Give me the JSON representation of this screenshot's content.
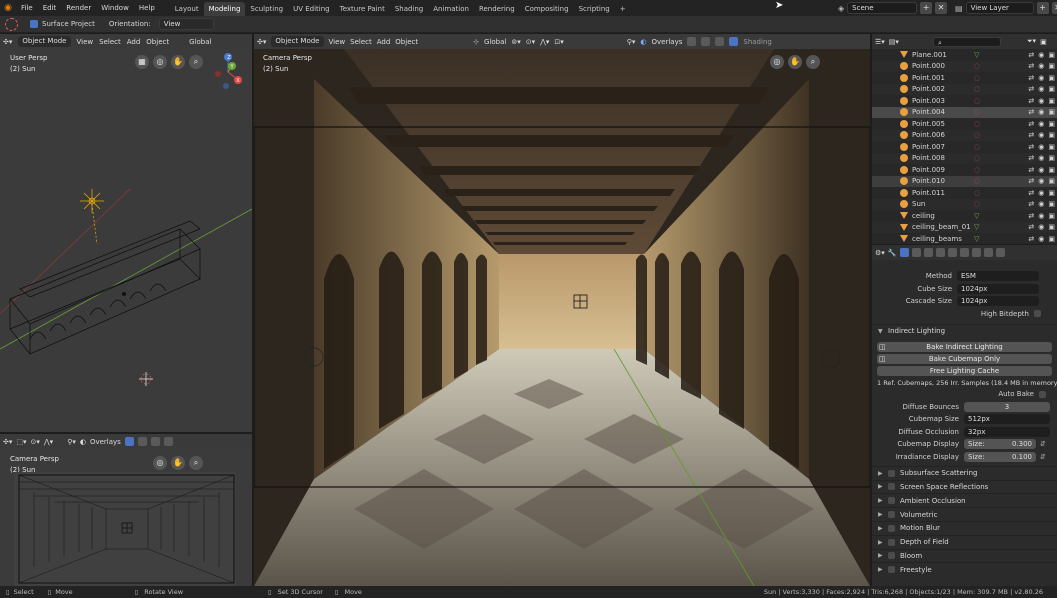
{
  "menu": [
    "File",
    "Edit",
    "Render",
    "Window",
    "Help"
  ],
  "workspaces": [
    "Layout",
    "Modeling",
    "Sculpting",
    "UV Editing",
    "Texture Paint",
    "Shading",
    "Animation",
    "Rendering",
    "Compositing",
    "Scripting"
  ],
  "active_workspace": "Modeling",
  "add_tab": "+",
  "scene": "Scene",
  "view_layer": "View Layer",
  "tool_settings": {
    "surface_project": "Surface Project",
    "orientation_label": "Orientation:",
    "orientation_value": "View"
  },
  "viewport_header": {
    "mode": "Object Mode",
    "menus": [
      "View",
      "Select",
      "Add",
      "Object"
    ],
    "transform": "Global",
    "overlays": "Overlays",
    "shading": "Shading"
  },
  "left_viewport": {
    "title": "User Persp",
    "subtitle": "(2) Sun"
  },
  "camera_viewport": {
    "title": "Camera Persp",
    "subtitle": "(2) Sun",
    "overlays": "Overlays"
  },
  "main_viewport": {
    "title": "Camera Persp",
    "subtitle": "(2) Sun"
  },
  "gizmo_axes": [
    "X",
    "Y",
    "Z"
  ],
  "outliner": {
    "items": [
      {
        "name": "Plane.001",
        "icon": "mesh-icon"
      },
      {
        "name": "Point.000",
        "icon": "light-icon"
      },
      {
        "name": "Point.001",
        "icon": "light-icon"
      },
      {
        "name": "Point.002",
        "icon": "light-icon"
      },
      {
        "name": "Point.003",
        "icon": "light-icon"
      },
      {
        "name": "Point.004",
        "icon": "light-icon",
        "selected": true
      },
      {
        "name": "Point.005",
        "icon": "light-icon"
      },
      {
        "name": "Point.006",
        "icon": "light-icon"
      },
      {
        "name": "Point.007",
        "icon": "light-icon"
      },
      {
        "name": "Point.008",
        "icon": "light-icon"
      },
      {
        "name": "Point.009",
        "icon": "light-icon"
      },
      {
        "name": "Point.010",
        "icon": "light-icon",
        "highlight": true
      },
      {
        "name": "Point.011",
        "icon": "light-icon"
      },
      {
        "name": "Sun",
        "icon": "sun-icon"
      },
      {
        "name": "ceiling",
        "icon": "mesh-icon"
      },
      {
        "name": "ceiling_beam_01",
        "icon": "mesh-icon"
      },
      {
        "name": "ceiling_beams",
        "icon": "mesh-icon"
      }
    ]
  },
  "properties": {
    "shadows": {
      "method_label": "Method",
      "method_value": "ESM",
      "cube_size_label": "Cube Size",
      "cube_size_value": "1024px",
      "cascade_size_label": "Cascade Size",
      "cascade_size_value": "1024px",
      "high_bitdepth_label": "High Bitdepth"
    },
    "indirect": {
      "title": "Indirect Lighting",
      "bake_indirect": "Bake Indirect Lighting",
      "bake_cubemap": "Bake Cubemap Only",
      "free_cache": "Free Lighting Cache",
      "info": "1 Ref. Cubemaps, 256 Irr. Samples (18.4 MB in memory)",
      "auto_bake_label": "Auto Bake",
      "diffuse_bounces_label": "Diffuse Bounces",
      "diffuse_bounces_value": "3",
      "cubemap_size_label": "Cubemap Size",
      "cubemap_size_value": "512px",
      "diffuse_occlusion_label": "Diffuse Occlusion",
      "diffuse_occlusion_value": "32px",
      "cubemap_display_label": "Cubemap Display",
      "cubemap_display_size_label": "Size:",
      "cubemap_display_size_value": "0.300",
      "irradiance_display_label": "Irradiance Display",
      "irradiance_display_size_label": "Size:",
      "irradiance_display_size_value": "0.100"
    },
    "panels": [
      "Subsurface Scattering",
      "Screen Space Reflections",
      "Ambient Occlusion",
      "Volumetric",
      "Motion Blur",
      "Depth of Field",
      "Bloom",
      "Freestyle"
    ]
  },
  "status": {
    "select": "Select",
    "move": "Move",
    "rotate_view": "Rotate View",
    "set_cursor": "Set 3D Cursor",
    "move2": "Move",
    "stats": "Sun | Verts:3,330 | Faces:2,924 | Tris:6,268 | Objects:1/23 | Mem: 309.7 MB | v2.80.26"
  }
}
